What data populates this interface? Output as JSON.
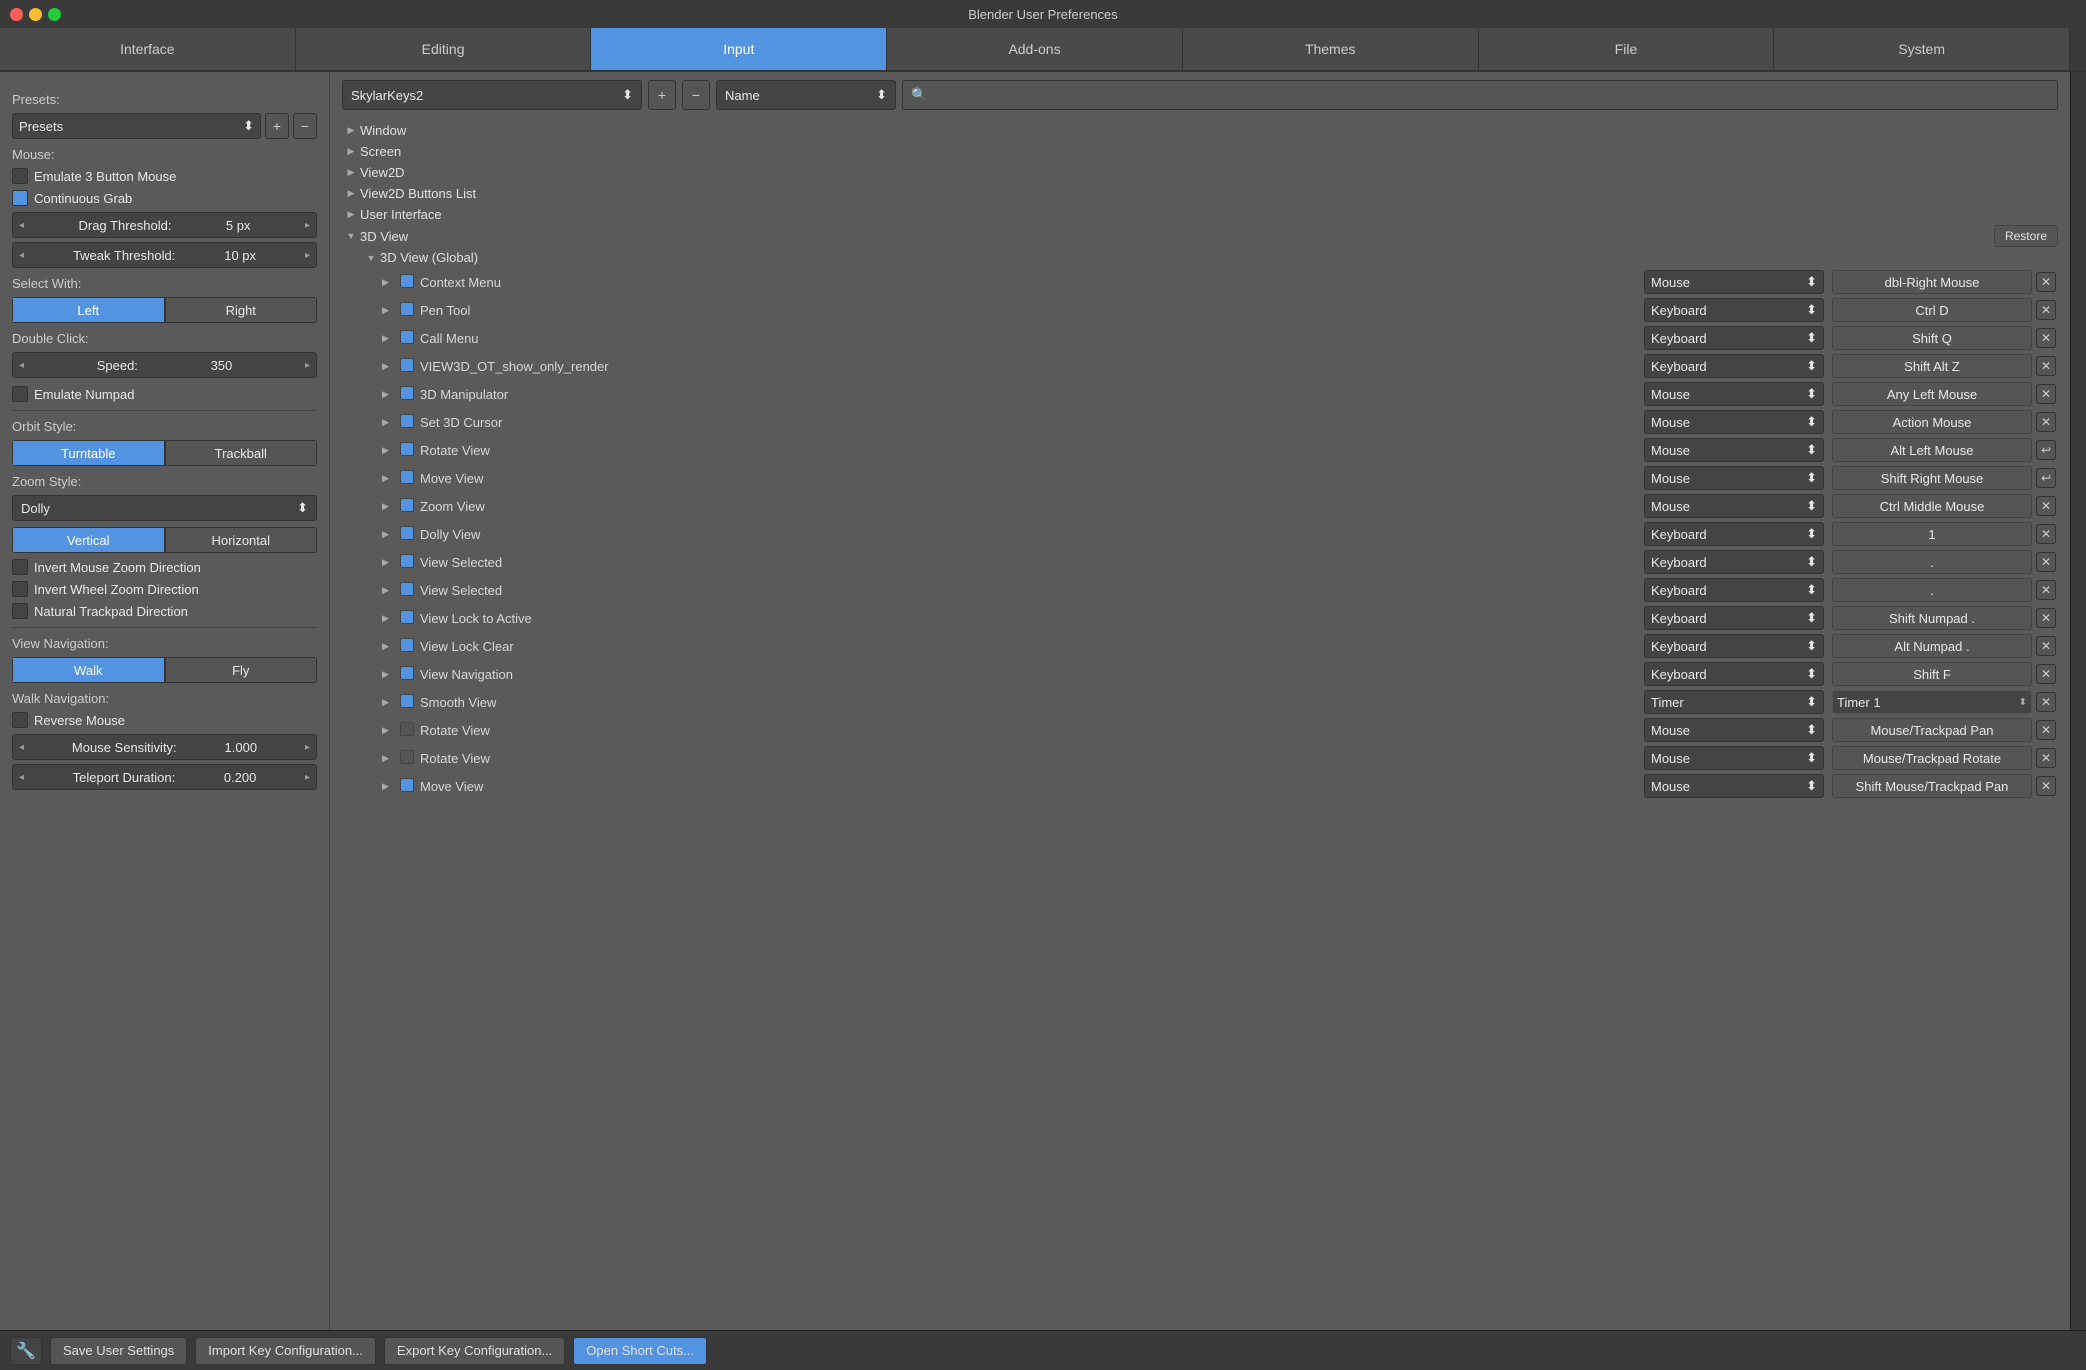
{
  "window": {
    "title": "Blender User Preferences"
  },
  "tabs": [
    {
      "label": "Interface",
      "active": false
    },
    {
      "label": "Editing",
      "active": false
    },
    {
      "label": "Input",
      "active": true
    },
    {
      "label": "Add-ons",
      "active": false
    },
    {
      "label": "Themes",
      "active": false
    },
    {
      "label": "File",
      "active": false
    },
    {
      "label": "System",
      "active": false
    }
  ],
  "left_panel": {
    "presets_label": "Presets:",
    "presets_value": "Presets",
    "mouse_label": "Mouse:",
    "emulate_3btn": "Emulate 3 Button Mouse",
    "continuous_grab": "Continuous Grab",
    "drag_threshold_label": "Drag Threshold:",
    "drag_threshold_value": "5 px",
    "tweak_threshold_label": "Tweak Threshold:",
    "tweak_threshold_value": "10 px",
    "select_with_label": "Select With:",
    "select_left": "Left",
    "select_right": "Right",
    "double_click_label": "Double Click:",
    "speed_label": "Speed:",
    "speed_value": "350",
    "emulate_numpad": "Emulate Numpad",
    "orbit_style_label": "Orbit Style:",
    "orbit_turntable": "Turntable",
    "orbit_trackball": "Trackball",
    "zoom_style_label": "Zoom Style:",
    "zoom_dolly": "Dolly",
    "zoom_vertical": "Vertical",
    "zoom_horizontal": "Horizontal",
    "invert_mouse_zoom": "Invert Mouse Zoom Direction",
    "invert_wheel_zoom": "Invert Wheel Zoom Direction",
    "natural_trackpad": "Natural Trackpad Direction",
    "view_nav_label": "View Navigation:",
    "view_walk": "Walk",
    "view_fly": "Fly",
    "walk_nav_label": "Walk Navigation:",
    "reverse_mouse": "Reverse Mouse",
    "mouse_sensitivity_label": "Mouse Sensitivity:",
    "mouse_sensitivity_value": "1.000",
    "teleport_duration_label": "Teleport Duration:",
    "teleport_duration_value": "0.200"
  },
  "right_panel": {
    "preset_name": "SkylarKeys2",
    "name_filter": "Name",
    "restore_label": "Restore",
    "tree": [
      {
        "label": "Window",
        "expanded": false,
        "indent": 0
      },
      {
        "label": "Screen",
        "expanded": false,
        "indent": 0
      },
      {
        "label": "View2D",
        "expanded": false,
        "indent": 0
      },
      {
        "label": "View2D Buttons List",
        "expanded": false,
        "indent": 0
      },
      {
        "label": "User Interface",
        "expanded": false,
        "indent": 0
      },
      {
        "label": "3D View",
        "expanded": true,
        "indent": 0
      },
      {
        "label": "3D View (Global)",
        "expanded": true,
        "indent": 1
      }
    ],
    "keybindings": [
      {
        "name": "Context Menu",
        "enabled": true,
        "type": "Mouse",
        "key": "dbl-Right Mouse",
        "has_enter": false
      },
      {
        "name": "Pen Tool",
        "enabled": true,
        "type": "Keyboard",
        "key": "Ctrl D",
        "has_enter": false
      },
      {
        "name": "Call Menu",
        "enabled": true,
        "type": "Keyboard",
        "key": "Shift Q",
        "has_enter": false
      },
      {
        "name": "VIEW3D_OT_show_only_render",
        "enabled": true,
        "type": "Keyboard",
        "key": "Shift Alt Z",
        "has_enter": false
      },
      {
        "name": "3D Manipulator",
        "enabled": true,
        "type": "Mouse",
        "key": "Any Left Mouse",
        "has_enter": false
      },
      {
        "name": "Set 3D Cursor",
        "enabled": true,
        "type": "Mouse",
        "key": "Action Mouse",
        "has_enter": false
      },
      {
        "name": "Rotate View",
        "enabled": true,
        "type": "Mouse",
        "key": "Alt Left Mouse",
        "has_enter": true
      },
      {
        "name": "Move View",
        "enabled": true,
        "type": "Mouse",
        "key": "Shift Right Mouse",
        "has_enter": true
      },
      {
        "name": "Zoom View",
        "enabled": true,
        "type": "Mouse",
        "key": "Ctrl Middle Mouse",
        "has_enter": false
      },
      {
        "name": "Dolly View",
        "enabled": true,
        "type": "Keyboard",
        "key": "1",
        "has_enter": false
      },
      {
        "name": "View Selected",
        "enabled": true,
        "type": "Keyboard",
        "key": ".",
        "has_enter": false
      },
      {
        "name": "View Selected",
        "enabled": true,
        "type": "Keyboard",
        "key": ".",
        "has_enter": false
      },
      {
        "name": "View Lock to Active",
        "enabled": true,
        "type": "Keyboard",
        "key": "Shift Numpad .",
        "has_enter": false
      },
      {
        "name": "View Lock Clear",
        "enabled": true,
        "type": "Keyboard",
        "key": "Alt Numpad .",
        "has_enter": false
      },
      {
        "name": "View Navigation",
        "enabled": true,
        "type": "Keyboard",
        "key": "Shift F",
        "has_enter": false
      },
      {
        "name": "Smooth View",
        "enabled": true,
        "type": "Timer",
        "key": "Timer 1",
        "has_enter": false
      },
      {
        "name": "Rotate View",
        "enabled": false,
        "type": "Mouse",
        "key": "Mouse/Trackpad Pan",
        "has_enter": false
      },
      {
        "name": "Rotate View",
        "enabled": false,
        "type": "Mouse",
        "key": "Mouse/Trackpad Rotate",
        "has_enter": false
      },
      {
        "name": "Move View",
        "enabled": true,
        "type": "Mouse",
        "key": "Shift Mouse/Trackpad Pan",
        "has_enter": false
      }
    ]
  },
  "bottom_bar": {
    "save_label": "Save User Settings",
    "import_label": "Import Key Configuration...",
    "export_label": "Export Key Configuration...",
    "open_short_label": "Open Short Cuts..."
  }
}
